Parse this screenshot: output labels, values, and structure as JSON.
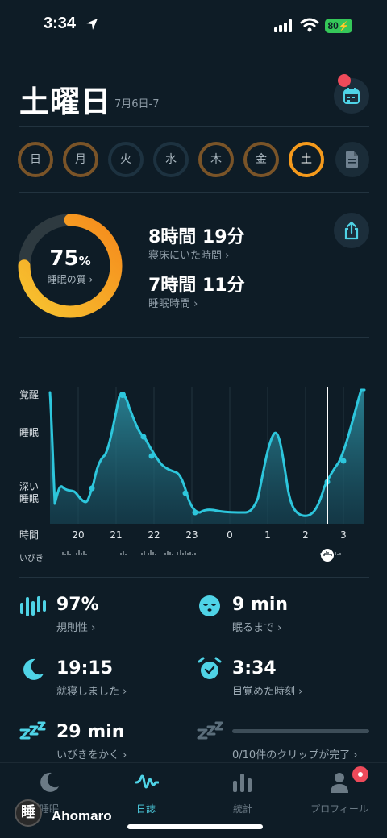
{
  "status_bar": {
    "time": "3:34",
    "battery": "80"
  },
  "header": {
    "day": "土曜日",
    "date_range": "7月6日-7"
  },
  "week": {
    "days": [
      {
        "label": "日",
        "state": "partial"
      },
      {
        "label": "月",
        "state": "partial"
      },
      {
        "label": "火",
        "state": "empty"
      },
      {
        "label": "水",
        "state": "empty"
      },
      {
        "label": "木",
        "state": "partial"
      },
      {
        "label": "金",
        "state": "partial"
      },
      {
        "label": "土",
        "state": "selected"
      }
    ]
  },
  "summary": {
    "quality_value": "75",
    "quality_unit": "%",
    "quality_fraction": 0.75,
    "quality_label": "睡眠の質 ›",
    "time_in_bed": "8時間 19分",
    "time_in_bed_label": "寝床にいた時間 ›",
    "sleep_time": "7時間 11分",
    "sleep_time_label": "睡眠時間 ›"
  },
  "graph": {
    "y_labels": [
      "覚醒",
      "睡眠",
      "深い\n睡眠"
    ],
    "x_axis_label": "時間",
    "x_ticks": [
      "20",
      "21",
      "22",
      "23",
      "0",
      "1",
      "2",
      "3"
    ],
    "snore_label": "いびき"
  },
  "stats": {
    "regularity_value": "97%",
    "regularity_label": "規則性 ›",
    "fall_asleep_value": "9 min",
    "fall_asleep_label": "眠るまで ›",
    "bedtime_value": "19:15",
    "bedtime_label": "就寝しました ›",
    "wakeup_value": "3:34",
    "wakeup_label": "目覚めた時刻 ›",
    "snoring_value": "29 min",
    "snoring_label": "いびきをかく ›",
    "clips_label": "0/10件のクリップが完了 ›",
    "clips_fraction": 0
  },
  "tabs": [
    {
      "label": "睡眠",
      "icon": "moon-icon"
    },
    {
      "label": "日誌",
      "icon": "waveform-icon"
    },
    {
      "label": "統計",
      "icon": "bar-chart-icon"
    },
    {
      "label": "プロフィール",
      "icon": "person-icon"
    }
  ],
  "watermark": {
    "logo": "睡",
    "name": "Ahomaro"
  },
  "colors": {
    "accent": "#4fd3e6",
    "quality_ring": "#f5a623",
    "background": "#0e1c26",
    "badge": "#ee4a5a"
  }
}
